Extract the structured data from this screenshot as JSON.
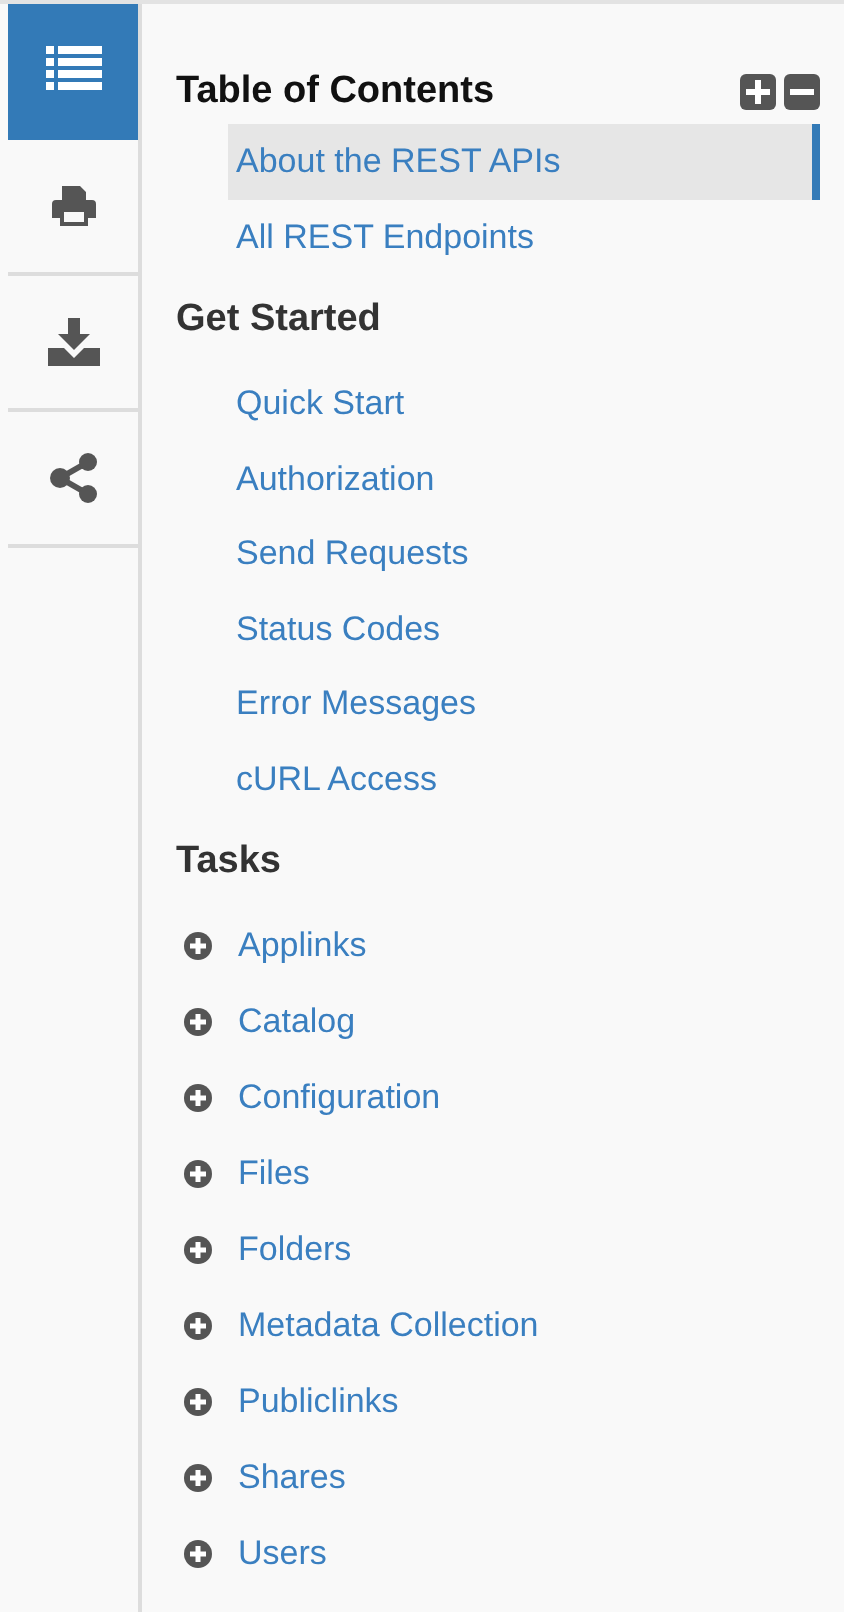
{
  "sidebar_tabs": [
    {
      "kind": "contents",
      "selected": true
    },
    {
      "kind": "print",
      "selected": false
    },
    {
      "kind": "download",
      "selected": false
    },
    {
      "kind": "share",
      "selected": false
    }
  ],
  "toc": {
    "title": "Table of Contents",
    "items": [
      {
        "label": "About the REST APIs",
        "selected": true
      },
      {
        "label": "All REST Endpoints",
        "selected": false
      }
    ],
    "sections": [
      {
        "heading": "Get Started",
        "items": [
          {
            "label": "Quick Start",
            "selected": false
          },
          {
            "label": "Authorization",
            "selected": false
          },
          {
            "label": "Send Requests",
            "selected": false
          },
          {
            "label": "Status Codes",
            "selected": false
          },
          {
            "label": "Error Messages",
            "selected": false
          },
          {
            "label": "cURL Access",
            "selected": false
          }
        ]
      },
      {
        "heading": "Tasks",
        "items": [
          {
            "label": "Applinks",
            "selected": false,
            "expanded": false
          },
          {
            "label": "Catalog",
            "selected": false,
            "expanded": false
          },
          {
            "label": "Configuration",
            "selected": false,
            "expanded": false
          },
          {
            "label": "Files",
            "selected": false,
            "expanded": false
          },
          {
            "label": "Folders",
            "selected": false,
            "expanded": false
          },
          {
            "label": "Metadata Collection",
            "selected": false,
            "expanded": false
          },
          {
            "label": "Publiclinks",
            "selected": false,
            "expanded": false
          },
          {
            "label": "Shares",
            "selected": false,
            "expanded": false
          },
          {
            "label": "Users",
            "selected": false,
            "expanded": false
          }
        ]
      }
    ]
  }
}
